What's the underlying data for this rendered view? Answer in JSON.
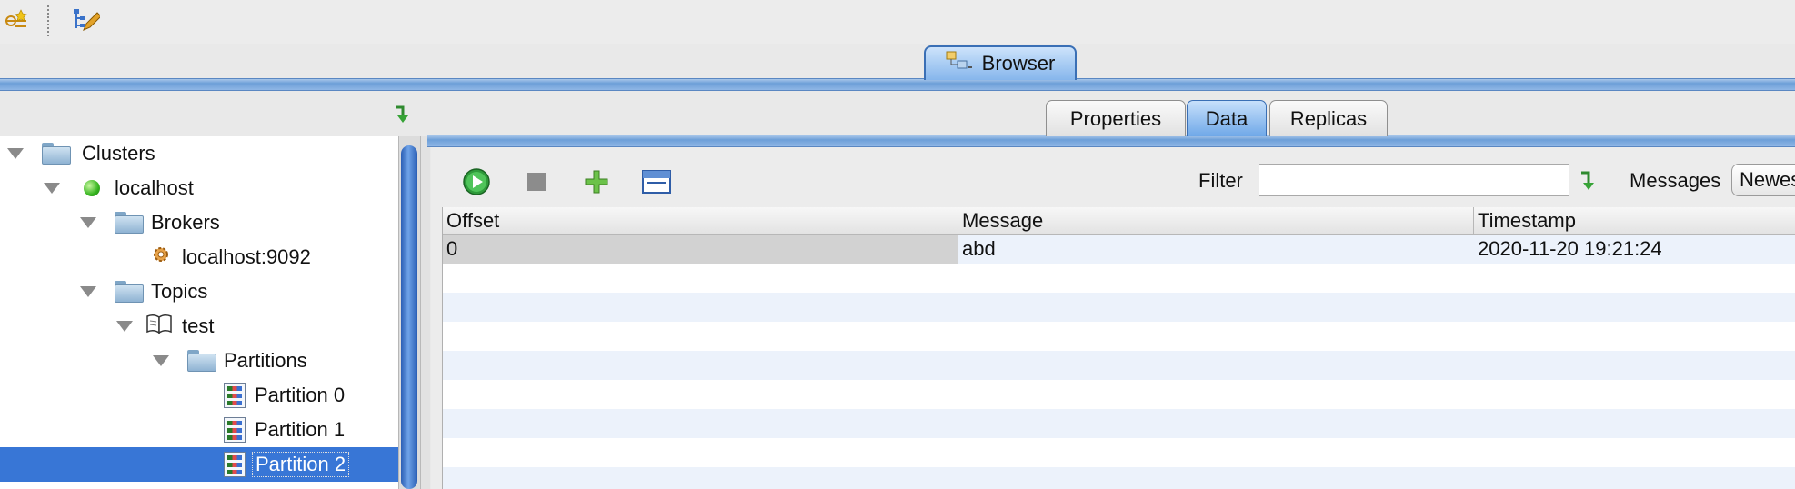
{
  "toolbar": {
    "icons": [
      "add-cluster-icon",
      "edit-tree-icon"
    ]
  },
  "browser_tab": {
    "label": "Browser",
    "icon": "browser-tree-icon"
  },
  "tree": {
    "items": [
      {
        "label": "Clusters",
        "icon": "folder-icon"
      },
      {
        "label": "localhost",
        "icon": "green-status-icon"
      },
      {
        "label": "Brokers",
        "icon": "folder-icon"
      },
      {
        "label": "localhost:9092",
        "icon": "broker-gear-icon"
      },
      {
        "label": "Topics",
        "icon": "folder-icon"
      },
      {
        "label": "test",
        "icon": "topic-book-icon"
      },
      {
        "label": "Partitions",
        "icon": "folder-icon"
      },
      {
        "label": "Partition 0",
        "icon": "partition-icon"
      },
      {
        "label": "Partition 1",
        "icon": "partition-icon"
      },
      {
        "label": "Partition 2",
        "icon": "partition-icon",
        "selected": true
      }
    ]
  },
  "sub_tabs": [
    {
      "label": "Properties"
    },
    {
      "label": "Data",
      "active": true
    },
    {
      "label": "Replicas"
    }
  ],
  "data_toolbar": {
    "icons": [
      "play-icon",
      "stop-icon",
      "add-icon",
      "window-icon"
    ],
    "filter_label": "Filter",
    "filter_value": "",
    "messages_label": "Messages",
    "messages_value": "Newes"
  },
  "table": {
    "columns": [
      "Offset",
      "Message",
      "Timestamp"
    ],
    "rows": [
      {
        "offset": "0",
        "message": "abd",
        "timestamp": "2020-11-20 19:21:24"
      }
    ]
  },
  "colors": {
    "selection": "#3876d6",
    "tab_blue": "#6fa8e8",
    "row_stripe": "#ecf2fb"
  }
}
